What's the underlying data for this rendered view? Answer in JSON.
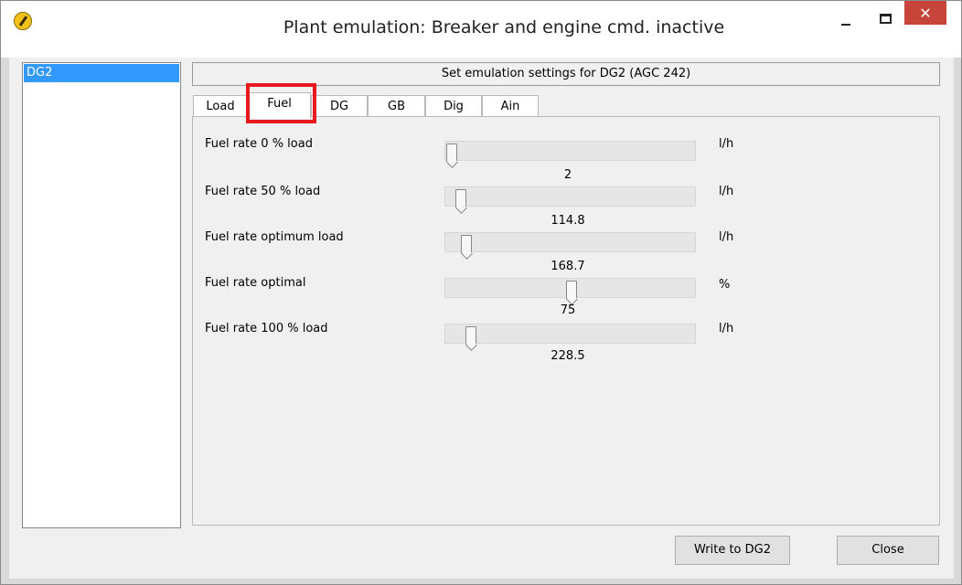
{
  "window": {
    "title": "Plant emulation: Breaker and engine cmd. inactive",
    "close_glyph": "✕"
  },
  "list": {
    "items": [
      "DG2"
    ]
  },
  "header": {
    "text": "Set emulation settings for DG2 (AGC 242)"
  },
  "tabs": {
    "load": "Load",
    "fuel": "Fuel",
    "dg": "DG",
    "gb": "GB",
    "dig": "Dig",
    "ain": "Ain",
    "active": "Fuel"
  },
  "settings": [
    {
      "label": "Fuel rate 0 % load",
      "value": "2",
      "unit": "l/h",
      "slider_fraction": 0.0
    },
    {
      "label": "Fuel rate 50 % load",
      "value": "114.8",
      "unit": "l/h",
      "slider_fraction": 0.04
    },
    {
      "label": "Fuel rate optimum load",
      "value": "168.7",
      "unit": "l/h",
      "slider_fraction": 0.06
    },
    {
      "label": "Fuel rate optimal",
      "value": "75",
      "unit": "%",
      "slider_fraction": 0.5
    },
    {
      "label": "Fuel rate 100 % load",
      "value": "228.5",
      "unit": "l/h",
      "slider_fraction": 0.08
    }
  ],
  "buttons": {
    "write": "Write to DG2",
    "close": "Close"
  },
  "colors": {
    "selection": "#3399ff",
    "close_button": "#c7443b",
    "highlight": "#e8181e"
  },
  "icons": [
    "app-icon",
    "minimize-icon",
    "maximize-icon",
    "close-icon"
  ]
}
